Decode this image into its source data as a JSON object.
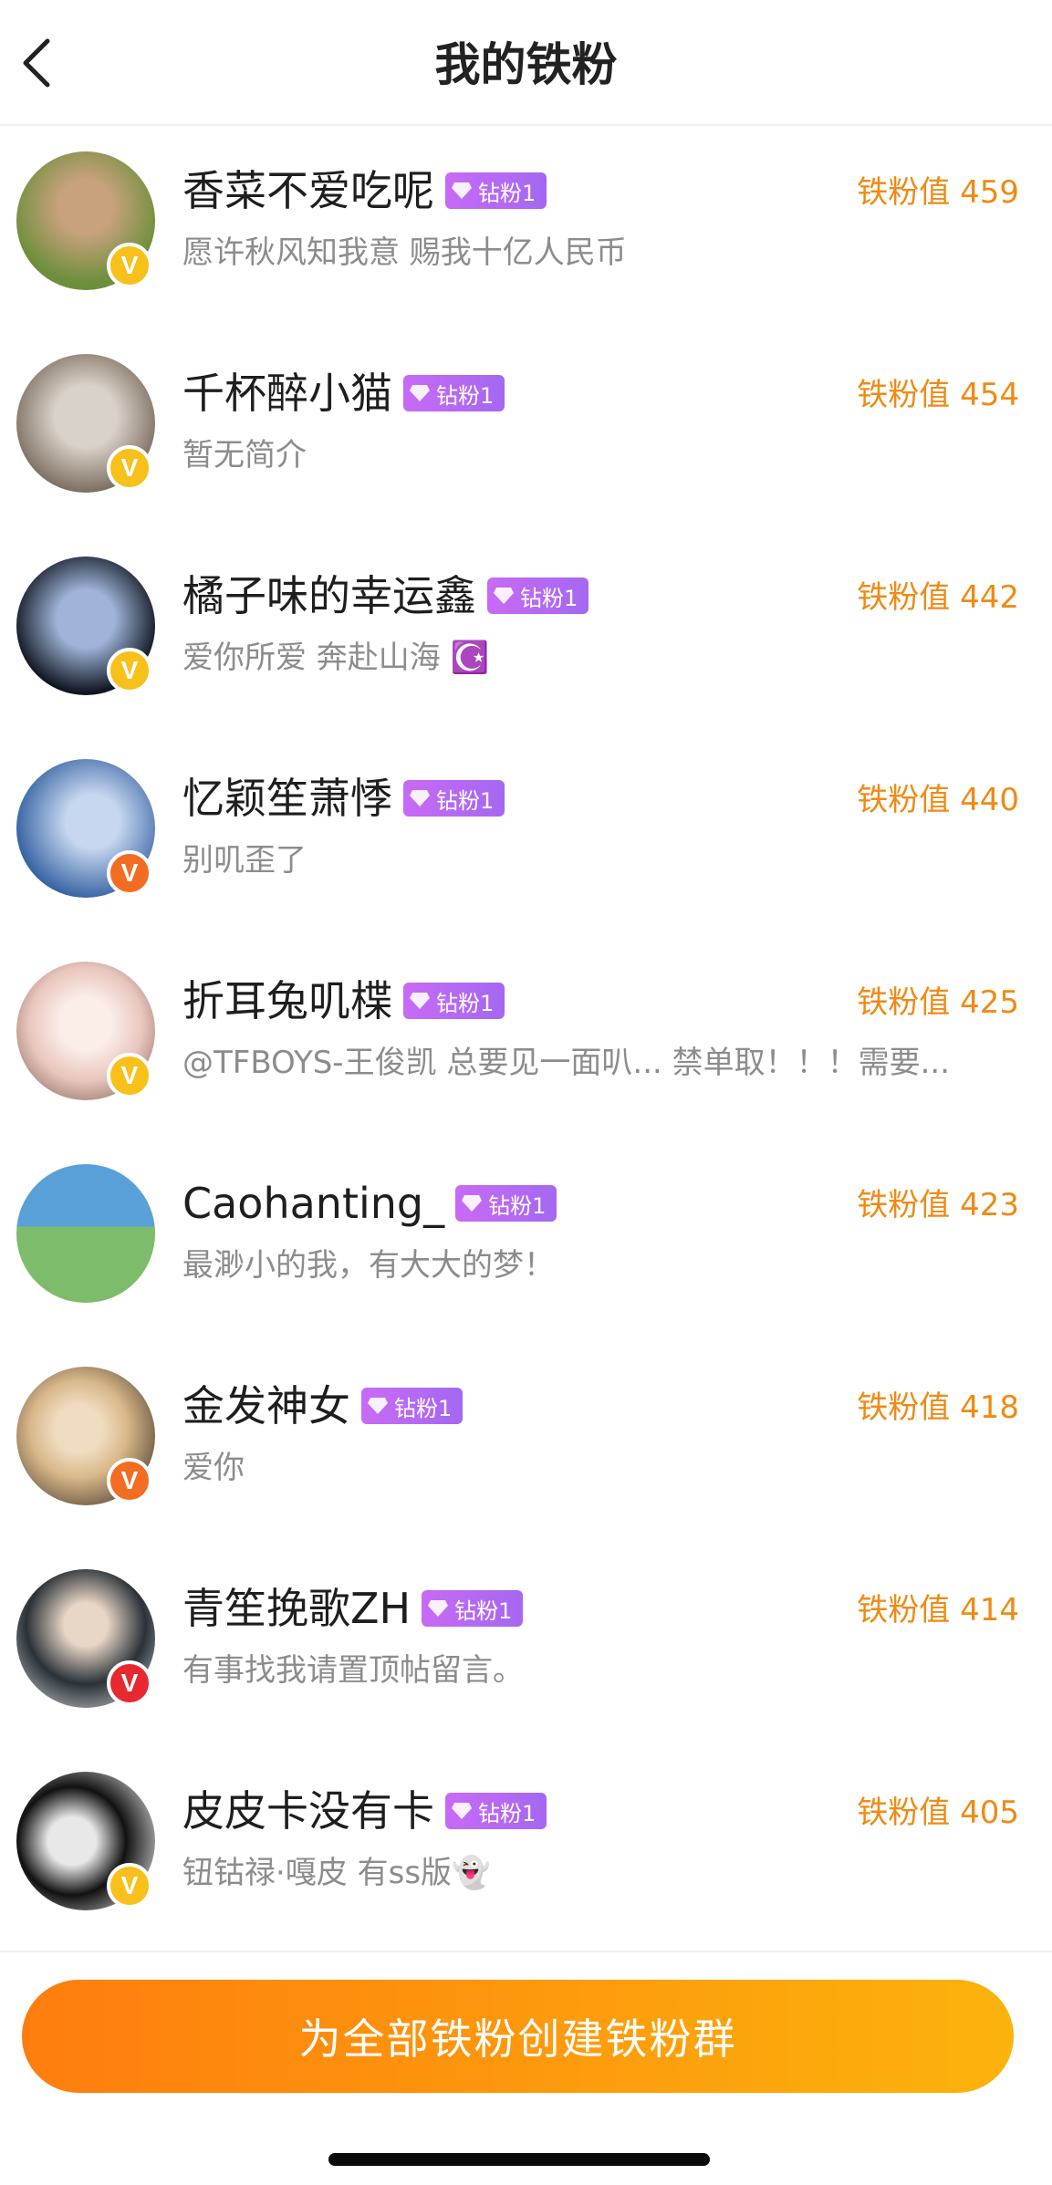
{
  "header": {
    "title": "我的铁粉"
  },
  "fans": [
    {
      "name": "香菜不爱吃呢",
      "tag": "钻粉1",
      "bio": "愿许秋风知我意 赐我十亿人民币",
      "score": "铁粉值 459",
      "badge": "V",
      "badge_color": "gold",
      "avatar_colors": [
        "#6d8f3b",
        "#c7a27d"
      ]
    },
    {
      "name": "千杯醉小猫",
      "tag": "钻粉1",
      "bio": "暂无简介",
      "score": "铁粉值 454",
      "badge": "V",
      "badge_color": "gold",
      "avatar_colors": [
        "#7a6b5e",
        "#d9d2c8"
      ]
    },
    {
      "name": "橘子味的幸运鑫",
      "tag": "钻粉1",
      "bio": "爱你所爱 奔赴山海 ☪️",
      "score": "铁粉值 442",
      "badge": "V",
      "badge_color": "gold",
      "avatar_colors": [
        "#0f1520",
        "#9fb4d8"
      ]
    },
    {
      "name": "忆颖笙萧悸",
      "tag": "钻粉1",
      "bio": "别叽歪了",
      "score": "铁粉值 440",
      "badge": "V",
      "badge_color": "orange",
      "avatar_colors": [
        "#2f5d9e",
        "#c6d7ef"
      ]
    },
    {
      "name": "折耳兔叽楪",
      "tag": "钻粉1",
      "bio": "@TFBOYS-王俊凯 总要见一面叭... 禁单取！！！需要...",
      "score": "铁粉值 425",
      "badge": "V",
      "badge_color": "gold",
      "avatar_colors": [
        "#e9c6be",
        "#fbeee9"
      ]
    },
    {
      "name": "Caohanting_",
      "tag": "钻粉1",
      "bio": "最渺小的我，有大大的梦！",
      "score": "铁粉值 423",
      "badge": "",
      "badge_color": "",
      "avatar_colors": [
        "#5aa0d8",
        "#7cbc6a"
      ]
    },
    {
      "name": "金发神女",
      "tag": "钻粉1",
      "bio": "爱你",
      "score": "铁粉值 418",
      "badge": "V",
      "badge_color": "orange",
      "avatar_colors": [
        "#d9b88a",
        "#433528"
      ]
    },
    {
      "name": "青笙挽歌ZH",
      "tag": "钻粉1",
      "bio": "有事找我请置顶帖留言。",
      "score": "铁粉值 414",
      "badge": "V",
      "badge_color": "red",
      "avatar_colors": [
        "#2a3238",
        "#c9cdd0"
      ]
    },
    {
      "name": "皮皮卡没有卡",
      "tag": "钻粉1",
      "bio": "钮钴禄·嘎皮 有ss版👻",
      "score": "铁粉值 405",
      "badge": "V",
      "badge_color": "gold",
      "avatar_colors": [
        "#111111",
        "#e8e8e8"
      ]
    }
  ],
  "footer": {
    "button_label": "为全部铁粉创建铁粉群"
  }
}
